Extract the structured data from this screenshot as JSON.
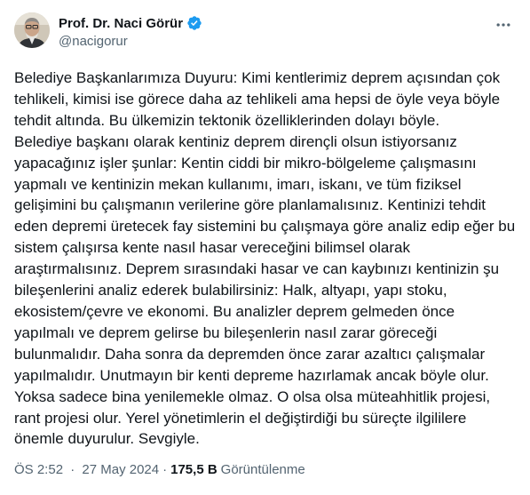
{
  "author": {
    "name": "Prof. Dr. Naci Görür",
    "handle": "@nacigorur",
    "verified": true,
    "verified_color": "#1d9bf0"
  },
  "tweet": {
    "text": "Belediye Başkanlarımıza Duyuru: Kimi kentlerimiz deprem açısından çok tehlikeli, kimisi ise görece daha az tehlikeli ama hepsi de öyle veya böyle tehdit altında. Bu ülkemizin tektonik özelliklerinden dolayı böyle.\nBelediye başkanı olarak kentiniz deprem dirençli olsun istiyorsanız yapacağınız işler şunlar: Kentin ciddi bir mikro-bölgeleme çalışmasını yapmalı ve kentinizin mekan kullanımı, imarı, iskanı, ve tüm fiziksel gelişimini bu çalışmanın verilerine göre planlamalısınız. Kentinizi tehdit eden depremi üretecek fay sistemini bu çalışmaya göre analiz edip eğer bu sistem çalışırsa kente nasıl hasar vereceğini bilimsel olarak araştırmalısınız. Deprem sırasındaki hasar ve can kaybınızı kentinizin şu bileşenlerini analiz ederek bulabilirsiniz: Halk, altyapı, yapı stoku, ekosistem/çevre ve ekonomi. Bu analizler deprem gelmeden önce yapılmalı ve deprem gelirse bu bileşenlerin nasıl zarar göreceği bulunmalıdır. Daha sonra da depremden önce zarar azaltıcı çalışmalar yapılmalıdır. Unutmayın bir kenti depreme hazırlamak ancak böyle olur. Yoksa sadece bina yenilemekle olmaz. O olsa olsa müteahhitlik projesi, rant projesi olur. Yerel yönetimlerin el değiştirdiği bu süreçte ilgililere önemle duyurulur. Sevgiyle."
  },
  "meta": {
    "time": "ÖS 2:52",
    "separator": "·",
    "date": "27 May 2024",
    "views_count": "175,5 B",
    "views_label": "Görüntülenme"
  },
  "icons": {
    "more": "more-horizontal-icon",
    "verified": "verified-badge-icon"
  }
}
